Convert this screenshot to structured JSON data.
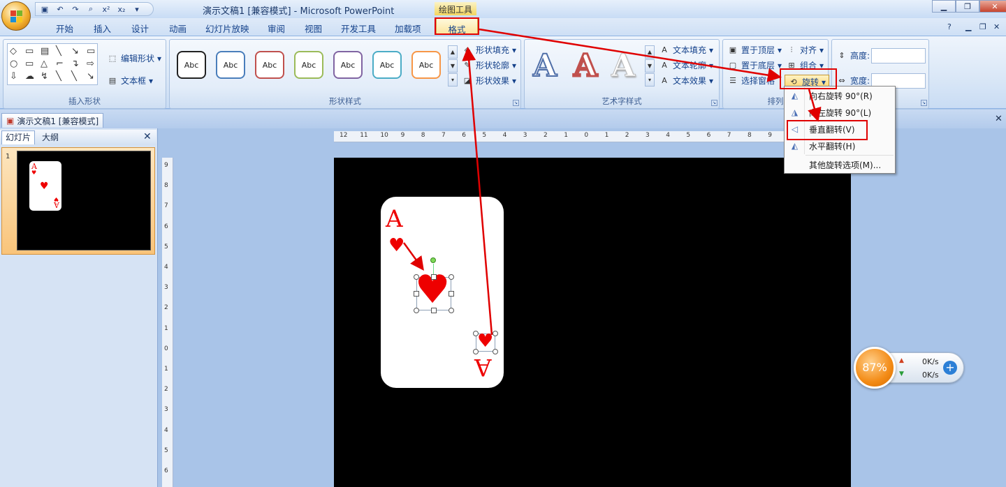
{
  "window": {
    "title": "演示文稿1 [兼容模式] - Microsoft PowerPoint",
    "context_tool": "绘图工具"
  },
  "tabs": [
    "开始",
    "插入",
    "设计",
    "动画",
    "幻灯片放映",
    "审阅",
    "视图",
    "开发工具",
    "加载项",
    "格式"
  ],
  "active_tab": "格式",
  "ribbon": {
    "insert_shapes": {
      "label": "插入形状",
      "edit_shape": "编辑形状",
      "text_box": "文本框"
    },
    "shape_styles": {
      "label": "形状样式",
      "swatch_text": "Abc",
      "swatch_colors": [
        "#222222",
        "#4a7ebb",
        "#c0504d",
        "#9bbb59",
        "#8064a2",
        "#4bacc6",
        "#f79646"
      ],
      "fill": "形状填充",
      "outline": "形状轮廓",
      "effects": "形状效果"
    },
    "wordart": {
      "label": "艺术字样式",
      "letter": "A",
      "fill": "文本填充",
      "outline": "文本轮廓",
      "effects": "文本效果"
    },
    "arrange": {
      "label": "排列",
      "bring_front": "置于顶层",
      "send_back": "置于底层",
      "selection_pane": "选择窗格",
      "align": "对齐",
      "group": "组合",
      "rotate": "旋转"
    },
    "size": {
      "height_label": "高度:",
      "width_label": "宽度:"
    }
  },
  "rotate_menu": {
    "items": [
      "向右旋转 90°(R)",
      "向左旋转 90°(L)",
      "垂直翻转(V)",
      "水平翻转(H)",
      "其他旋转选项(M)..."
    ],
    "highlighted": "垂直翻转(V)"
  },
  "document_tab": "演示文稿1 [兼容模式]",
  "left_pane": {
    "tabs": [
      "幻灯片",
      "大纲"
    ],
    "slide_number": "1"
  },
  "card": {
    "rank": "A"
  },
  "hruler_labels": [
    "12",
    "11",
    "10",
    "9",
    "8",
    "7",
    "6",
    "5",
    "4",
    "3",
    "2",
    "1",
    "0",
    "1",
    "2",
    "3",
    "4",
    "5",
    "6",
    "7",
    "8",
    "9"
  ],
  "vruler_labels": [
    "9",
    "8",
    "7",
    "6",
    "5",
    "4",
    "3",
    "2",
    "1",
    "0",
    "1",
    "2",
    "3",
    "4",
    "5",
    "6"
  ],
  "speed_widget": {
    "percent": "87%",
    "up": "0K/s",
    "down": "0K/s"
  },
  "annotation_color": "#e00000"
}
